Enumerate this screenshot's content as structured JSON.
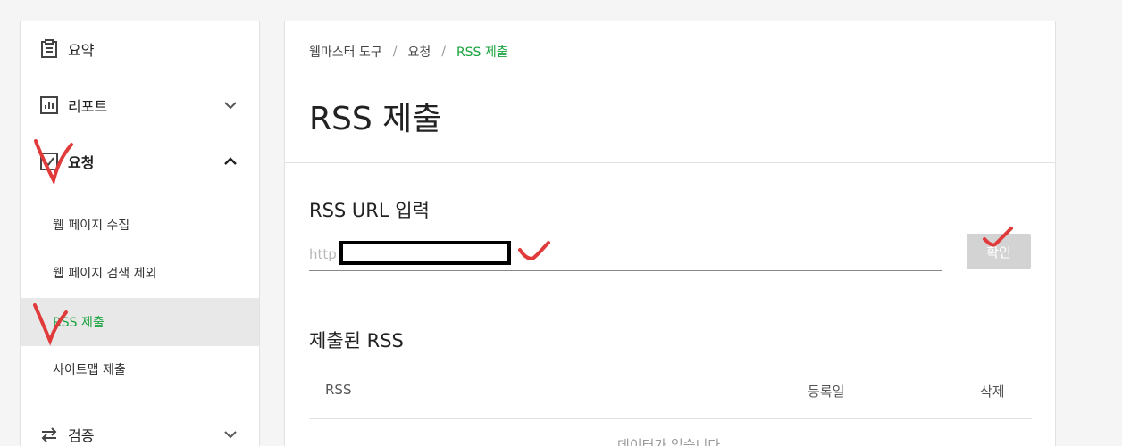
{
  "sidebar": {
    "items": [
      {
        "label": "요약"
      },
      {
        "label": "리포트"
      },
      {
        "label": "요청"
      },
      {
        "label": "검증"
      }
    ],
    "sub_items": [
      {
        "label": "웹 페이지 수집"
      },
      {
        "label": "웹 페이지 검색 제외"
      },
      {
        "label": "RSS 제출"
      },
      {
        "label": "사이트맵 제출"
      }
    ]
  },
  "breadcrumb": {
    "items": [
      "웹마스터 도구",
      "요청",
      "RSS 제출"
    ],
    "separator": "/"
  },
  "page": {
    "title": "RSS 제출"
  },
  "rss_input": {
    "section_title": "RSS URL 입력",
    "placeholder": "http",
    "button_label": "확인"
  },
  "submitted": {
    "section_title": "제출된 RSS",
    "columns": [
      "RSS",
      "등록일",
      "삭제"
    ],
    "empty_message": "데이터가 없습니다."
  },
  "colors": {
    "accent": "#19a33d",
    "annotation": "#e03a3a"
  }
}
